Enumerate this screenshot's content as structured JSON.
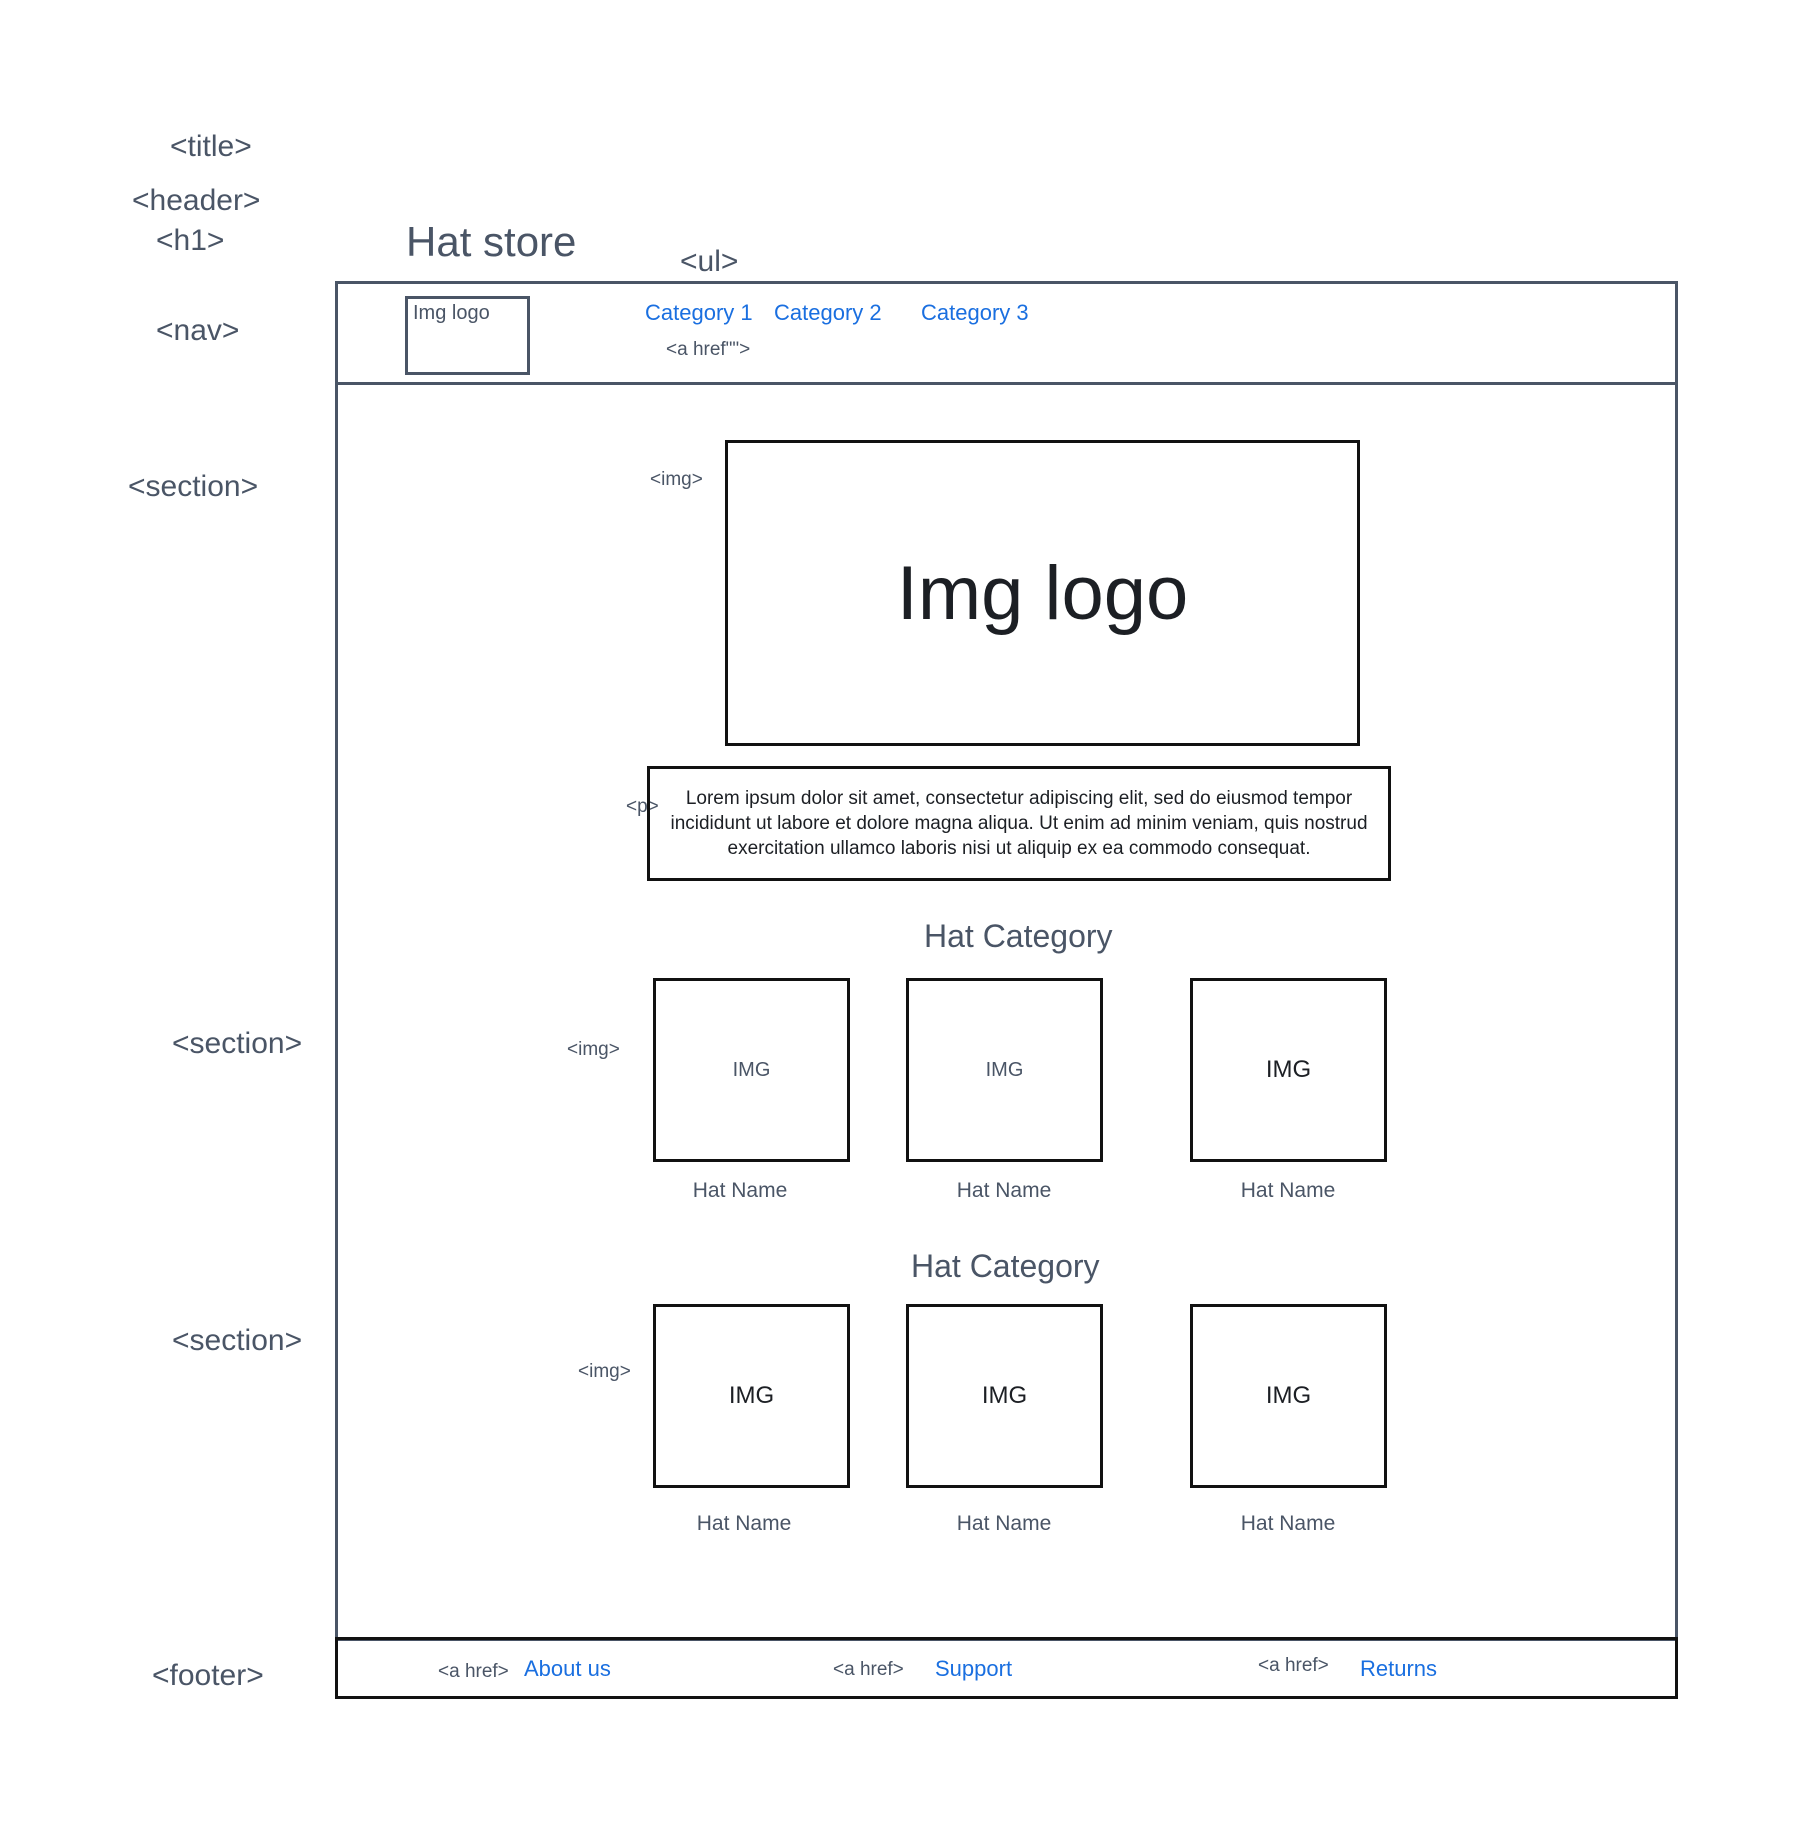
{
  "tag_labels": {
    "title": "<title>",
    "header": "<header>",
    "h1": "<h1>",
    "nav": "<nav>",
    "ul": "<ul>",
    "section_1": "<section>",
    "section_2": "<section>",
    "section_3": "<section>",
    "footer": "<footer>",
    "nav_a_href": "<a href\"\">",
    "hero_img": "<img>",
    "p": "<p>",
    "section_2_img": "<img>",
    "section_3_img": "<img>",
    "footer_a_href_1": "<a href>",
    "footer_a_href_2": "<a href>",
    "footer_a_href_3": "<a href>"
  },
  "header": {
    "site_title": "Hat store"
  },
  "nav": {
    "logo_label": "Img logo",
    "links": [
      "Category 1",
      "Category 2",
      "Category 3"
    ]
  },
  "hero": {
    "logo_label": "Img logo",
    "paragraph": "Lorem ipsum dolor sit amet, consectetur adipiscing elit, sed do eiusmod tempor incididunt ut labore et dolore magna aliqua. Ut enim ad minim veniam, quis nostrud exercitation ullamco laboris nisi ut aliquip ex ea commodo consequat."
  },
  "categories": [
    {
      "heading": "Hat Category",
      "items": [
        {
          "img": "IMG",
          "name": "Hat Name"
        },
        {
          "img": "IMG",
          "name": "Hat Name"
        },
        {
          "img": "IMG",
          "name": "Hat Name"
        }
      ]
    },
    {
      "heading": "Hat Category",
      "items": [
        {
          "img": "IMG",
          "name": "Hat Name"
        },
        {
          "img": "IMG",
          "name": "Hat Name"
        },
        {
          "img": "IMG",
          "name": "Hat Name"
        }
      ]
    }
  ],
  "footer": {
    "links": [
      "About us",
      "Support",
      "Returns"
    ]
  },
  "colors": {
    "annotation": "#4a5566",
    "link": "#1a6fe0",
    "box_border": "#111111"
  }
}
